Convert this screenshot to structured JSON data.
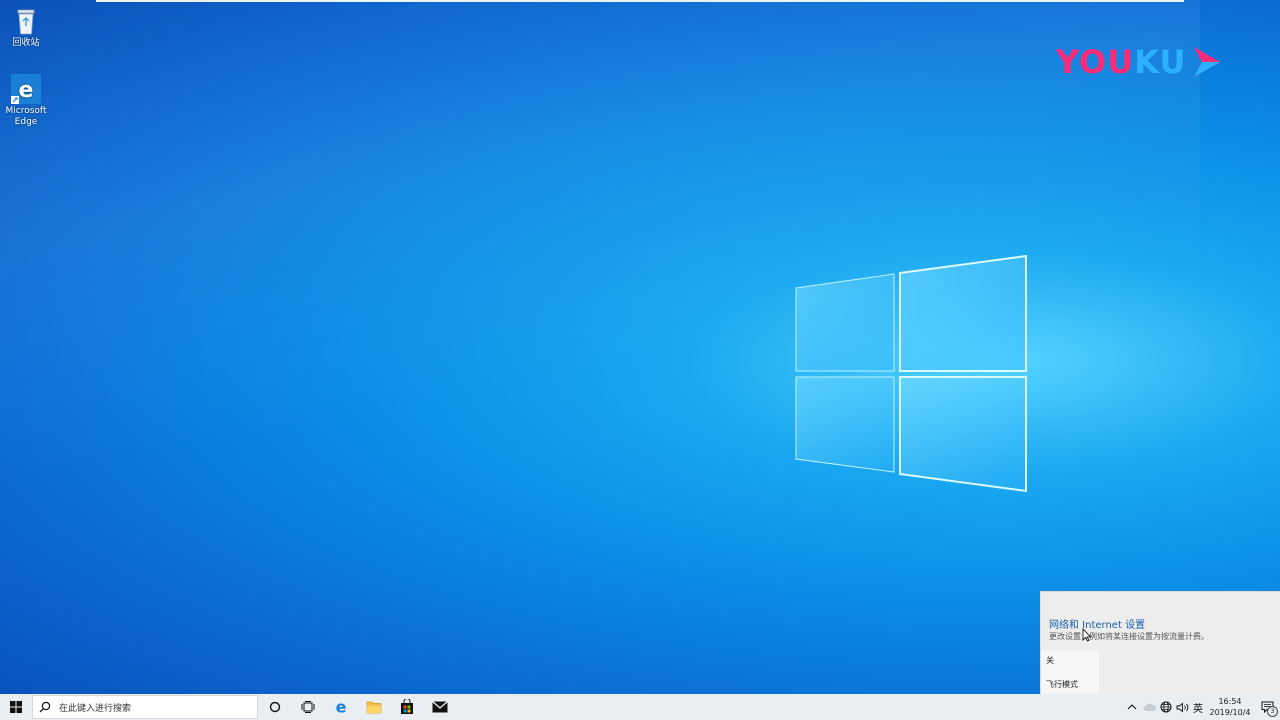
{
  "desktop": {
    "icons": [
      {
        "label": "回收站",
        "icon": "recycle-bin-icon"
      },
      {
        "label": "Microsoft Edge",
        "icon": "edge-icon"
      }
    ],
    "watermark": {
      "you": "YOU",
      "ku": "KU",
      "icon": "play-arrow-icon"
    }
  },
  "network_flyout": {
    "settings_link": "网络和 Internet 设置",
    "settings_desc": "更改设置，例如将某连接设置为按流量计费。",
    "airplane_tile": {
      "state": "关",
      "label": "飞行模式"
    }
  },
  "taskbar": {
    "search_placeholder": "在此键入进行搜索",
    "pinned": [
      "cortana-icon",
      "task-view-icon",
      "edge-icon",
      "file-explorer-icon",
      "store-icon",
      "mail-icon"
    ],
    "tray": {
      "ime": "英",
      "time": "16:54",
      "date": "2019/10/4",
      "notification_count": "3"
    }
  },
  "colors": {
    "accent": "#0a8fe6",
    "taskbar": "#e9eef3",
    "link": "#1b5fa8"
  }
}
